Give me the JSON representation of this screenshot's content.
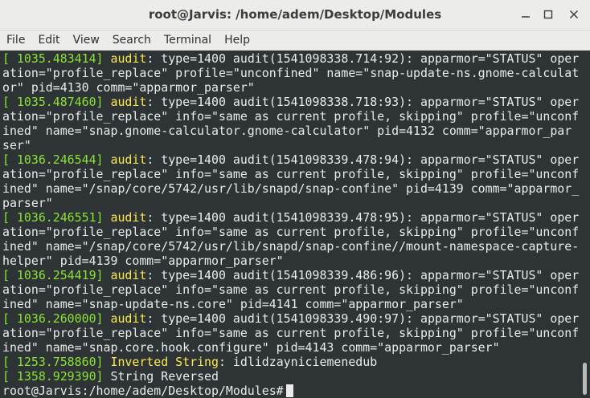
{
  "window": {
    "title": "root@Jarvis: /home/adem/Desktop/Modules"
  },
  "menu": [
    "File",
    "Edit",
    "View",
    "Search",
    "Terminal",
    "Help"
  ],
  "terminal": {
    "lines": [
      [
        {
          "t": "[ 1035.483414] ",
          "c": "green"
        },
        {
          "t": "audit",
          "c": "yellow"
        },
        {
          "t": ": type=1400 audit(1541098338.714:92): apparmor=\"STATUS\" oper"
        }
      ],
      [
        {
          "t": "ation=\"profile_replace\" profile=\"unconfined\" name=\"snap-update-ns.gnome-calculat"
        }
      ],
      [
        {
          "t": "or\" pid=4130 comm=\"apparmor_parser\""
        }
      ],
      [
        {
          "t": "[ 1035.487460] ",
          "c": "green"
        },
        {
          "t": "audit",
          "c": "yellow"
        },
        {
          "t": ": type=1400 audit(1541098338.718:93): apparmor=\"STATUS\" oper"
        }
      ],
      [
        {
          "t": "ation=\"profile_replace\" info=\"same as current profile, skipping\" profile=\"unconf"
        }
      ],
      [
        {
          "t": "ined\" name=\"snap.gnome-calculator.gnome-calculator\" pid=4132 comm=\"apparmor_par"
        }
      ],
      [
        {
          "t": "ser\""
        }
      ],
      [
        {
          "t": "[ 1036.246544] ",
          "c": "green"
        },
        {
          "t": "audit",
          "c": "yellow"
        },
        {
          "t": ": type=1400 audit(1541098339.478:94): apparmor=\"STATUS\" oper"
        }
      ],
      [
        {
          "t": "ation=\"profile_replace\" info=\"same as current profile, skipping\" profile=\"unconf"
        }
      ],
      [
        {
          "t": "ined\" name=\"/snap/core/5742/usr/lib/snapd/snap-confine\" pid=4139 comm=\"apparmor_"
        }
      ],
      [
        {
          "t": "parser\""
        }
      ],
      [
        {
          "t": "[ 1036.246551] ",
          "c": "green"
        },
        {
          "t": "audit",
          "c": "yellow"
        },
        {
          "t": ": type=1400 audit(1541098339.478:95): apparmor=\"STATUS\" oper"
        }
      ],
      [
        {
          "t": "ation=\"profile_replace\" info=\"same as current profile, skipping\" profile=\"unconf"
        }
      ],
      [
        {
          "t": "ined\" name=\"/snap/core/5742/usr/lib/snapd/snap-confine//mount-namespace-capture-"
        }
      ],
      [
        {
          "t": "helper\" pid=4139 comm=\"apparmor_parser\""
        }
      ],
      [
        {
          "t": "[ 1036.254419] ",
          "c": "green"
        },
        {
          "t": "audit",
          "c": "yellow"
        },
        {
          "t": ": type=1400 audit(1541098339.486:96): apparmor=\"STATUS\" oper"
        }
      ],
      [
        {
          "t": "ation=\"profile_replace\" info=\"same as current profile, skipping\" profile=\"unconf"
        }
      ],
      [
        {
          "t": "ined\" name=\"snap-update-ns.core\" pid=4141 comm=\"apparmor_parser\""
        }
      ],
      [
        {
          "t": "[ 1036.260000] ",
          "c": "green"
        },
        {
          "t": "audit",
          "c": "yellow"
        },
        {
          "t": ": type=1400 audit(1541098339.490:97): apparmor=\"STATUS\" oper"
        }
      ],
      [
        {
          "t": "ation=\"profile_replace\" info=\"same as current profile, skipping\" profile=\"unconf"
        }
      ],
      [
        {
          "t": "ined\" name=\"snap.core.hook.configure\" pid=4143 comm=\"apparmor_parser\""
        }
      ],
      [
        {
          "t": "[ 1253.758860] ",
          "c": "green"
        },
        {
          "t": "Inverted String",
          "c": "yellow"
        },
        {
          "t": ": idlidzayniciemenedub"
        }
      ],
      [
        {
          "t": "[ 1358.929390] ",
          "c": "green"
        },
        {
          "t": "String Reversed"
        }
      ]
    ],
    "prompt": "root@Jarvis:/home/adem/Desktop/Modules# "
  },
  "colors": {
    "green": "#8ae234",
    "yellow": "#fce94f",
    "text": "#e9ecea",
    "background": "#2e3436"
  }
}
